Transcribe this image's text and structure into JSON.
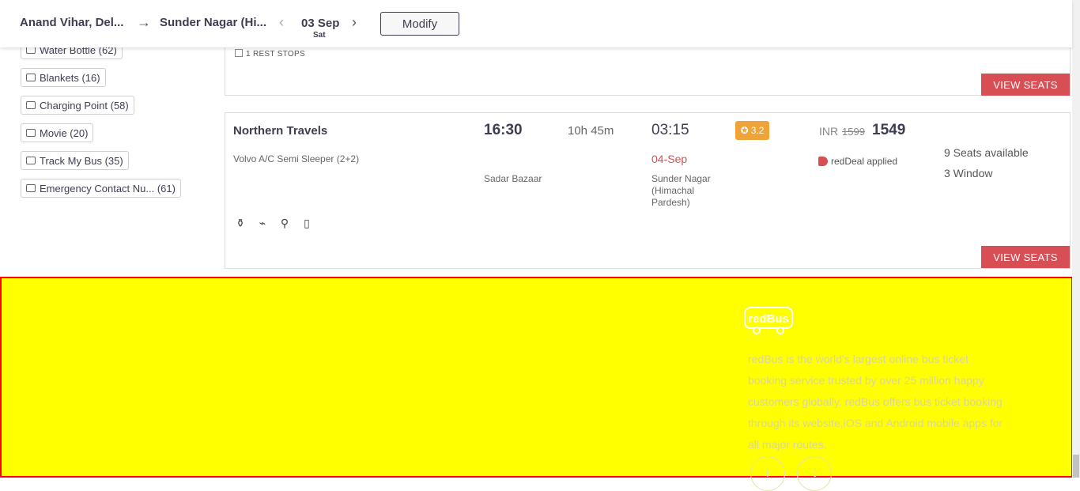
{
  "header": {
    "source": "Anand Vihar, Del...",
    "destination": "Sunder Nagar (Hi...",
    "date": "03 Sep",
    "day": "Sat",
    "modify_label": "Modify"
  },
  "filters": [
    {
      "label": "Water Bottle (62)",
      "icon": "water-bottle-icon"
    },
    {
      "label": "Blankets (16)",
      "icon": "blanket-icon"
    },
    {
      "label": "Charging Point (58)",
      "icon": "charging-point-icon"
    },
    {
      "label": "Movie (20)",
      "icon": "movie-icon"
    },
    {
      "label": "Track My Bus (35)",
      "icon": "track-bus-icon"
    },
    {
      "label": "Emergency Contact Nu... (61)",
      "icon": "emergency-contact-icon"
    }
  ],
  "prev_card": {
    "rest_stops": "1 REST STOPS",
    "view_seats_label": "VIEW SEATS"
  },
  "bus": {
    "operator": "Northern Travels",
    "bus_type": "Volvo A/C Semi Sleeper (2+2)",
    "departure_time": "16:30",
    "duration": "10h 45m",
    "arrival_time": "03:15",
    "arrival_date": "04-Sep",
    "departure_location": "Sadar Bazaar",
    "arrival_location": "Sunder Nagar (Himachal Pardesh)",
    "rating": "3.2",
    "currency": "INR",
    "original_price": "1599",
    "price": "1549",
    "deal_text": "redDeal applied",
    "seats_available": "9 Seats available",
    "window_seats": "3 Window",
    "amenities": [
      "water-bottle-icon",
      "charging-point-icon",
      "reading-light-icon",
      "track-bus-icon"
    ],
    "view_seats_label": "VIEW SEATS"
  },
  "footer": {
    "logo_text": "redBus",
    "about": "redBus is the world's largest online bus ticket booking service trusted by over 25 million happy customers globally. redBus offers bus ticket booking through its website,iOS and Android mobile apps for all major routes.",
    "social": [
      "f",
      "t"
    ]
  },
  "colors": {
    "accent": "#d84e55",
    "rating": "#f0a336",
    "footer_bg": "#ffff00",
    "footer_border": "#ff0000"
  }
}
